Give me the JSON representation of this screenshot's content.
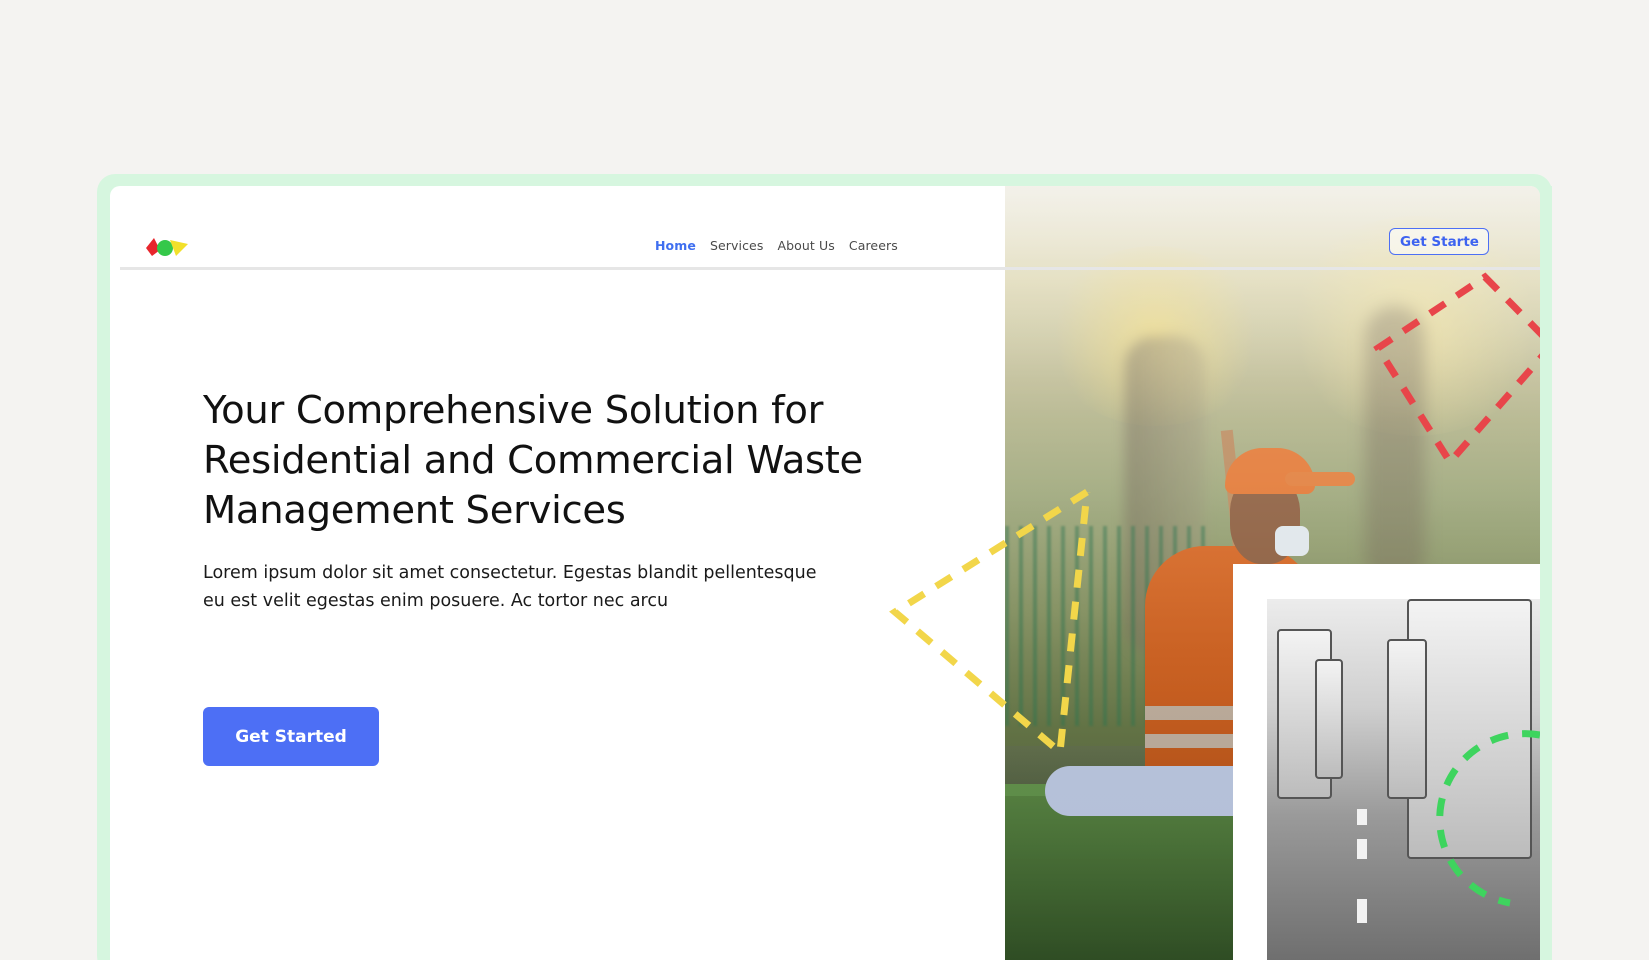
{
  "brand": {
    "logo_colors": [
      "#e8262d",
      "#35c84a",
      "#f2e02a"
    ]
  },
  "nav": {
    "items": [
      {
        "label": "Home",
        "active": true
      },
      {
        "label": "Services",
        "active": false
      },
      {
        "label": "About Us",
        "active": false
      },
      {
        "label": "Careers",
        "active": false
      }
    ],
    "cta_label": "Get Starte"
  },
  "hero": {
    "title": "Your Comprehensive Solution for Residential and Commercial Waste Management Services",
    "subtitle": "Lorem ipsum dolor sit amet consectetur. Egestas blandit pellentesque eu est velit egestas enim posuere. Ac tortor nec arcu",
    "cta_label": "Get Started"
  },
  "colors": {
    "accent": "#4d6ff5",
    "frame": "#d6f6df",
    "background": "#f4f3f1",
    "deco_yellow": "#f2d64a",
    "deco_red": "#e8454a",
    "deco_green": "#3ed45e"
  },
  "images": {
    "main_photo": "waste-worker-photo",
    "inset_photo": "trucks-photo"
  }
}
